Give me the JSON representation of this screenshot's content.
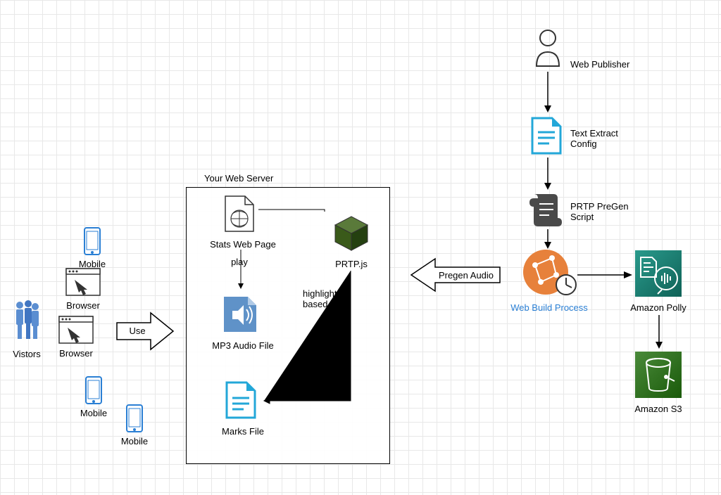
{
  "server": {
    "title": "Your Web Server"
  },
  "visitors": "Vistors",
  "browser1": "Browser",
  "browser2": "Browser",
  "mobile1": "Mobile",
  "mobile2": "Mobile",
  "mobile3": "Mobile",
  "useArrow": "Use",
  "stats": "Stats Web Page",
  "play": "play",
  "mp3": "MP3 Audio File",
  "marks": "Marks File",
  "prtpjs": "PRTP.js",
  "highlight": "highlight\nbased on",
  "pregenArrow": "Pregen Audio",
  "webPublisher": "Web Publisher",
  "textExtract": "Text Extract\nConfig",
  "prtpScript": "PRTP PreGen\nScript",
  "buildProcess": "Web Build Process",
  "polly": "Amazon Polly",
  "s3": "Amazon S3"
}
